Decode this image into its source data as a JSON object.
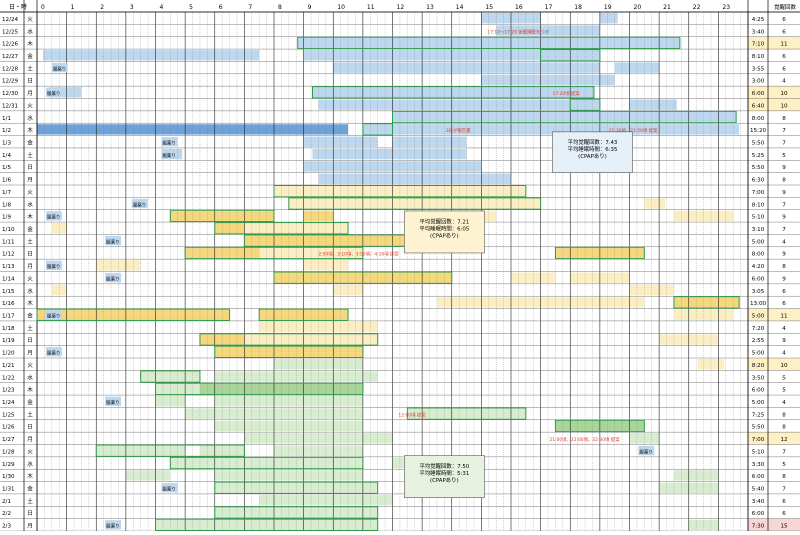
{
  "header": {
    "date_col": "日・時",
    "hours": [
      "0",
      "1",
      "2",
      "3",
      "4",
      "5",
      "6",
      "7",
      "8",
      "9",
      "10",
      "11",
      "12",
      "13",
      "14",
      "15",
      "16",
      "17",
      "18",
      "19",
      "20",
      "21",
      "22",
      "23"
    ],
    "wake_col": "覚醒回数"
  },
  "rows": [
    {
      "date": "12/24",
      "dow": "火",
      "sleep": "4:25",
      "wake": "6",
      "hl": ""
    },
    {
      "date": "12/25",
      "dow": "水",
      "sleep": "3:40",
      "wake": "6",
      "hl": ""
    },
    {
      "date": "12/26",
      "dow": "木",
      "sleep": "7:10",
      "wake": "11",
      "hl": "y"
    },
    {
      "date": "12/27",
      "dow": "金",
      "sleep": "8:10",
      "wake": "6",
      "hl": ""
    },
    {
      "date": "12/28",
      "dow": "土",
      "sleep": "3:55",
      "wake": "6",
      "hl": ""
    },
    {
      "date": "12/29",
      "dow": "日",
      "sleep": "3:00",
      "wake": "4",
      "hl": ""
    },
    {
      "date": "12/30",
      "dow": "月",
      "sleep": "6:00",
      "wake": "10",
      "hl": "y"
    },
    {
      "date": "12/31",
      "dow": "火",
      "sleep": "6:40",
      "wake": "10",
      "hl": "y"
    },
    {
      "date": "1/1",
      "dow": "水",
      "sleep": "8:00",
      "wake": "8",
      "hl": ""
    },
    {
      "date": "1/2",
      "dow": "木",
      "sleep": "15:20",
      "wake": "7",
      "hl": ""
    },
    {
      "date": "1/3",
      "dow": "金",
      "sleep": "5:50",
      "wake": "7",
      "hl": ""
    },
    {
      "date": "1/4",
      "dow": "土",
      "sleep": "5:25",
      "wake": "5",
      "hl": ""
    },
    {
      "date": "1/5",
      "dow": "日",
      "sleep": "5:50",
      "wake": "9",
      "hl": ""
    },
    {
      "date": "1/6",
      "dow": "月",
      "sleep": "6:30",
      "wake": "8",
      "hl": ""
    },
    {
      "date": "1/7",
      "dow": "火",
      "sleep": "7:00",
      "wake": "9",
      "hl": ""
    },
    {
      "date": "1/8",
      "dow": "水",
      "sleep": "8:10",
      "wake": "7",
      "hl": ""
    },
    {
      "date": "1/9",
      "dow": "木",
      "sleep": "5:10",
      "wake": "9",
      "hl": ""
    },
    {
      "date": "1/10",
      "dow": "金",
      "sleep": "3:10",
      "wake": "7",
      "hl": ""
    },
    {
      "date": "1/11",
      "dow": "土",
      "sleep": "5:00",
      "wake": "4",
      "hl": ""
    },
    {
      "date": "1/12",
      "dow": "日",
      "sleep": "8:00",
      "wake": "9",
      "hl": ""
    },
    {
      "date": "1/13",
      "dow": "月",
      "sleep": "4:20",
      "wake": "8",
      "hl": ""
    },
    {
      "date": "1/14",
      "dow": "火",
      "sleep": "6:00",
      "wake": "9",
      "hl": ""
    },
    {
      "date": "1/15",
      "dow": "水",
      "sleep": "3:05",
      "wake": "6",
      "hl": ""
    },
    {
      "date": "1/16",
      "dow": "木",
      "sleep": "13:00",
      "wake": "6",
      "hl": ""
    },
    {
      "date": "1/17",
      "dow": "金",
      "sleep": "5:00",
      "wake": "11",
      "hl": "y"
    },
    {
      "date": "1/18",
      "dow": "土",
      "sleep": "7:20",
      "wake": "4",
      "hl": ""
    },
    {
      "date": "1/19",
      "dow": "日",
      "sleep": "2:55",
      "wake": "9",
      "hl": ""
    },
    {
      "date": "1/20",
      "dow": "月",
      "sleep": "5:00",
      "wake": "4",
      "hl": ""
    },
    {
      "date": "1/21",
      "dow": "火",
      "sleep": "8:20",
      "wake": "10",
      "hl": "y"
    },
    {
      "date": "1/22",
      "dow": "水",
      "sleep": "3:50",
      "wake": "5",
      "hl": ""
    },
    {
      "date": "1/23",
      "dow": "木",
      "sleep": "6:00",
      "wake": "5",
      "hl": ""
    },
    {
      "date": "1/24",
      "dow": "金",
      "sleep": "5:00",
      "wake": "4",
      "hl": ""
    },
    {
      "date": "1/25",
      "dow": "土",
      "sleep": "7:25",
      "wake": "8",
      "hl": ""
    },
    {
      "date": "1/26",
      "dow": "日",
      "sleep": "5:50",
      "wake": "8",
      "hl": ""
    },
    {
      "date": "1/27",
      "dow": "月",
      "sleep": "7:00",
      "wake": "12",
      "hl": "y"
    },
    {
      "date": "1/28",
      "dow": "火",
      "sleep": "5:10",
      "wake": "7",
      "hl": ""
    },
    {
      "date": "1/29",
      "dow": "水",
      "sleep": "3:30",
      "wake": "5",
      "hl": ""
    },
    {
      "date": "1/30",
      "dow": "木",
      "sleep": "6:00",
      "wake": "8",
      "hl": ""
    },
    {
      "date": "1/31",
      "dow": "金",
      "sleep": "5:40",
      "wake": "7",
      "hl": ""
    },
    {
      "date": "2/1",
      "dow": "土",
      "sleep": "3:40",
      "wake": "6",
      "hl": ""
    },
    {
      "date": "2/2",
      "dow": "日",
      "sleep": "6:00",
      "wake": "6",
      "hl": ""
    },
    {
      "date": "2/3",
      "dow": "月",
      "sleep": "7:30",
      "wake": "15",
      "hl": "p"
    }
  ],
  "colors": {
    "blue": "#bcd7ee",
    "blue_dark": "#6fa2d6",
    "yellow": "#f5d77e",
    "yellow_light": "#fbeec2",
    "green": "#a9d49a",
    "green_light": "#d8ecd0",
    "border": "#2e9a4a",
    "red": "#e23a2a",
    "grid": "#777",
    "grid_bold": "#222",
    "hl_yellow": "#fdf0c4",
    "hl_pink": "#f8d6d6"
  },
  "segments": [
    [
      0,
      15,
      17,
      "b"
    ],
    [
      0,
      19,
      19.6,
      "b"
    ],
    [
      1,
      15.5,
      19,
      "b"
    ],
    [
      2,
      8.8,
      21.7,
      "b"
    ],
    [
      3,
      9,
      19,
      "b"
    ],
    [
      3,
      0.2,
      7.5,
      "bl"
    ],
    [
      4,
      10,
      19,
      "b"
    ],
    [
      4,
      19.5,
      21,
      "b"
    ],
    [
      5,
      15,
      19.5,
      "b"
    ],
    [
      6,
      9.3,
      18.8,
      "b"
    ],
    [
      6,
      0.4,
      1.5,
      "bl"
    ],
    [
      7,
      9.5,
      19,
      "b"
    ],
    [
      7,
      20,
      21.6,
      "b"
    ],
    [
      8,
      12,
      23.6,
      "b"
    ],
    [
      9,
      0,
      10.5,
      "B"
    ],
    [
      9,
      11,
      23.7,
      "b"
    ],
    [
      10,
      9,
      11.5,
      "b"
    ],
    [
      10,
      12,
      14.5,
      "b"
    ],
    [
      11,
      9.3,
      14.5,
      "b"
    ],
    [
      11,
      4.2,
      4.9,
      "b"
    ],
    [
      12,
      9,
      15,
      "b"
    ],
    [
      13,
      9.5,
      16,
      "b"
    ],
    [
      14,
      8,
      16.5,
      "y"
    ],
    [
      15,
      8.5,
      17,
      "y"
    ],
    [
      15,
      20.5,
      21.2,
      "y"
    ],
    [
      16,
      4.5,
      8,
      "Y"
    ],
    [
      16,
      9,
      10,
      "Y"
    ],
    [
      16,
      14,
      15.5,
      "y"
    ],
    [
      16,
      21.5,
      23.5,
      "y"
    ],
    [
      17,
      6,
      7,
      "Y"
    ],
    [
      17,
      7,
      10.5,
      "y"
    ],
    [
      17,
      0.5,
      1,
      "y"
    ],
    [
      18,
      7,
      14,
      "Y"
    ],
    [
      19,
      5,
      7.5,
      "Y"
    ],
    [
      19,
      7.5,
      11,
      "y"
    ],
    [
      19,
      17.5,
      20.5,
      "Y"
    ],
    [
      20,
      2,
      3.5,
      "y"
    ],
    [
      20,
      9,
      10.5,
      "y"
    ],
    [
      21,
      8,
      14,
      "Y"
    ],
    [
      21,
      16,
      17.5,
      "y"
    ],
    [
      21,
      18,
      20,
      "y"
    ],
    [
      22,
      0.5,
      1,
      "y"
    ],
    [
      22,
      10,
      11,
      "y"
    ],
    [
      22,
      20,
      21.5,
      "y"
    ],
    [
      23,
      13.5,
      20.5,
      "y"
    ],
    [
      23,
      21.5,
      23.7,
      "Y"
    ],
    [
      24,
      0,
      6.5,
      "Y"
    ],
    [
      24,
      7.5,
      10.5,
      "Y"
    ],
    [
      24,
      21.5,
      23.5,
      "y"
    ],
    [
      25,
      7.5,
      10,
      "y"
    ],
    [
      25,
      10,
      11.5,
      "y"
    ],
    [
      26,
      5.5,
      7,
      "Y"
    ],
    [
      26,
      7,
      11.5,
      "y"
    ],
    [
      26,
      21,
      23,
      "y"
    ],
    [
      27,
      6,
      11,
      "Y"
    ],
    [
      28,
      8,
      11,
      "g"
    ],
    [
      28,
      22.3,
      23.2,
      "y"
    ],
    [
      29,
      3.5,
      5.5,
      "g"
    ],
    [
      29,
      6,
      11.5,
      "g"
    ],
    [
      30,
      4,
      5.5,
      "g"
    ],
    [
      30,
      5.5,
      11,
      "G"
    ],
    [
      31,
      4,
      5,
      "g"
    ],
    [
      31,
      6,
      11,
      "g"
    ],
    [
      32,
      5,
      11,
      "g"
    ],
    [
      32,
      12.5,
      16.5,
      "g"
    ],
    [
      33,
      6,
      11,
      "g"
    ],
    [
      33,
      17.5,
      20.5,
      "G"
    ],
    [
      34,
      7,
      12,
      "g"
    ],
    [
      34,
      20,
      21,
      "g"
    ],
    [
      35,
      2,
      5,
      "g"
    ],
    [
      35,
      5.5,
      7,
      "g"
    ],
    [
      35,
      8,
      11,
      "g"
    ],
    [
      36,
      4.5,
      11,
      "g"
    ],
    [
      36,
      12,
      12.5,
      "g"
    ],
    [
      37,
      3,
      4.5,
      "g"
    ],
    [
      37,
      6,
      11,
      "g"
    ],
    [
      37,
      21.5,
      23,
      "g"
    ],
    [
      38,
      6,
      7,
      "g"
    ],
    [
      38,
      7,
      11.5,
      "g"
    ],
    [
      38,
      21,
      23,
      "g"
    ],
    [
      39,
      7.5,
      12,
      "g"
    ],
    [
      40,
      6,
      9.5,
      "g"
    ],
    [
      40,
      9.5,
      11.5,
      "g"
    ],
    [
      41,
      4,
      11.5,
      "g"
    ],
    [
      41,
      22,
      23,
      "g"
    ]
  ],
  "outlines": [
    [
      2,
      8.8,
      21.7
    ],
    [
      3,
      17,
      19
    ],
    [
      6,
      9.3,
      18.8
    ],
    [
      7,
      18,
      19
    ],
    [
      8,
      12,
      23.6
    ],
    [
      9,
      11,
      12
    ],
    [
      14,
      8,
      16.5
    ],
    [
      15,
      8.5,
      17
    ],
    [
      16,
      4.5,
      8
    ],
    [
      17,
      6,
      10.5
    ],
    [
      18,
      7,
      14
    ],
    [
      19,
      5,
      11
    ],
    [
      19,
      17.5,
      20.5
    ],
    [
      21,
      8,
      14
    ],
    [
      23,
      21.5,
      23.7
    ],
    [
      24,
      0,
      6.5
    ],
    [
      24,
      7.5,
      10.5
    ],
    [
      26,
      5.5,
      11.5
    ],
    [
      27,
      6,
      11
    ],
    [
      29,
      3.5,
      5.5
    ],
    [
      30,
      4,
      11
    ],
    [
      32,
      12.5,
      16.5
    ],
    [
      33,
      17.5,
      20.5
    ],
    [
      35,
      2,
      7
    ],
    [
      36,
      4.5,
      11
    ],
    [
      38,
      6,
      11.5
    ],
    [
      40,
      6,
      11.5
    ],
    [
      41,
      4,
      11.5
    ]
  ],
  "labels": [
    {
      "row": 4,
      "hour": 0.5,
      "text": "服薬り"
    },
    {
      "row": 6,
      "hour": 0.3,
      "text": "服薬り"
    },
    {
      "row": 10,
      "hour": 4.2,
      "text": "服薬り"
    },
    {
      "row": 11,
      "hour": 4.2,
      "text": "服薬り"
    },
    {
      "row": 15,
      "hour": 3.2,
      "text": "服薬り"
    },
    {
      "row": 16,
      "hour": 0.3,
      "text": "服薬り"
    },
    {
      "row": 18,
      "hour": 2.3,
      "text": "服薬り"
    },
    {
      "row": 20,
      "hour": 0.3,
      "text": "服薬り"
    },
    {
      "row": 21,
      "hour": 2.3,
      "text": "服薬り"
    },
    {
      "row": 24,
      "hour": 0.3,
      "text": "服薬り"
    },
    {
      "row": 27,
      "hour": 0.3,
      "text": "服薬り"
    },
    {
      "row": 31,
      "hour": 2.3,
      "text": "服薬り"
    },
    {
      "row": 35,
      "hour": 20.3,
      "text": "服薬り"
    },
    {
      "row": 38,
      "hour": 4.2,
      "text": "服薬り"
    },
    {
      "row": 41,
      "hour": 2.3,
      "text": "服薬り"
    }
  ],
  "red_notes": [
    {
      "row": 1,
      "hour": 15.2,
      "text": "17:10～17:20 仮眠睡眠をつき"
    },
    {
      "row": 6,
      "hour": 17.4,
      "text": "17:20頃 提案"
    },
    {
      "row": 9,
      "hour": 13.8,
      "text": "3日が報告書"
    },
    {
      "row": 9,
      "hour": 19.3,
      "text": "21:30頃、21:50頃 提案"
    },
    {
      "row": 19,
      "hour": 9.5,
      "text": "2:50頃、3:10頃、3:50頃、4:10頃 提案"
    },
    {
      "row": 32,
      "hour": 12.2,
      "text": "12:00頃 提案"
    },
    {
      "row": 34,
      "hour": 17.3,
      "text": "21:00頃、22:00頃、22:30頃 提案"
    }
  ],
  "summaries": [
    {
      "rowTop": 9.7,
      "hourL": 17.4,
      "hourR": 20.1,
      "rows": 3.3,
      "kind": "b",
      "lines": [
        "平均覚醒回数：7.43",
        "平均睡眠時間：6:35",
        "(CPAPあり)"
      ]
    },
    {
      "rowTop": 16.1,
      "hourL": 12.4,
      "hourR": 15.1,
      "rows": 3.4,
      "kind": "y",
      "lines": [
        "平均覚醒回数：7.21",
        "平均睡眠時間：6:05",
        "(CPAPあり)"
      ]
    },
    {
      "rowTop": 35.9,
      "hourL": 12.4,
      "hourR": 15.1,
      "rows": 3.4,
      "kind": "g",
      "lines": [
        "平均覚醒回数：7.50",
        "平均睡眠時間：5:31",
        "(CPAPあり)"
      ]
    }
  ]
}
